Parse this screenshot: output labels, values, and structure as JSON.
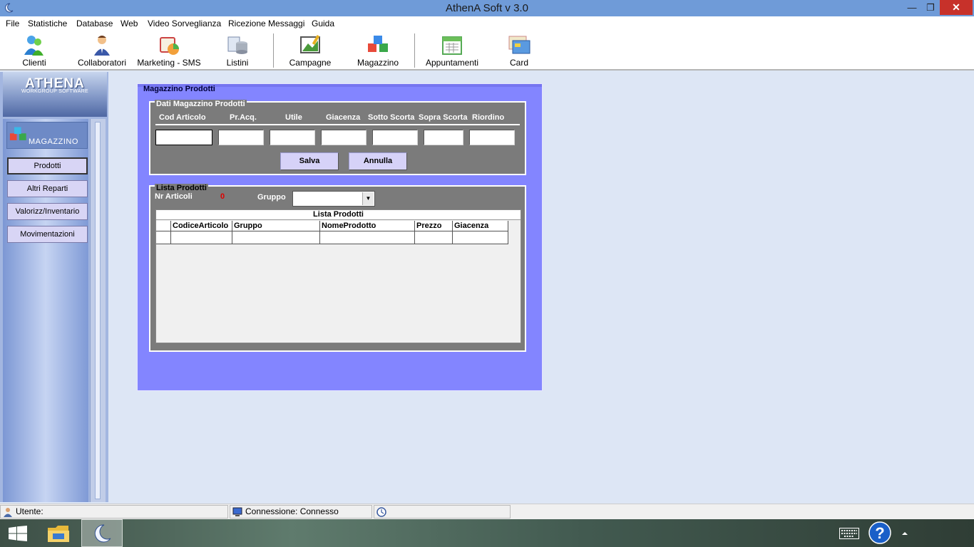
{
  "window": {
    "title": "AthenA Soft v 3.0",
    "min_symbol": "—",
    "max_symbol": "❐",
    "close_symbol": "✕"
  },
  "menu": [
    "File",
    "Statistiche",
    "Database",
    "Web",
    "Video Sorveglianza",
    "Ricezione Messaggi",
    "Guida"
  ],
  "toolbar": [
    {
      "label": "Clienti",
      "icon": "clients-icon"
    },
    {
      "label": "Collaboratori",
      "icon": "collaborators-icon"
    },
    {
      "label": "Marketing - SMS",
      "icon": "marketing-icon"
    },
    {
      "label": "Listini",
      "icon": "pricelist-icon"
    },
    {
      "label": "Campagne",
      "icon": "campaign-icon"
    },
    {
      "label": "Magazzino",
      "icon": "warehouse-icon"
    },
    {
      "label": "Appuntamenti",
      "icon": "calendar-icon"
    },
    {
      "label": "Card",
      "icon": "card-icon"
    }
  ],
  "sidebar": {
    "logo_name": "ATHENA",
    "logo_sub": "WORKGROUP SOFTWARE",
    "module": "MAGAZZINO",
    "items": [
      "Prodotti",
      "Altri Reparti",
      "Valorizz/Inventario",
      "Movimentazioni"
    ],
    "active_item": "Prodotti"
  },
  "form": {
    "title": "Magazzino Prodotti",
    "data_section": {
      "title": "Dati Magazzino Prodotti",
      "fields": [
        {
          "label": "Cod Articolo",
          "value": ""
        },
        {
          "label": "Pr.Acq.",
          "value": ""
        },
        {
          "label": "Utile",
          "value": ""
        },
        {
          "label": "Giacenza",
          "value": ""
        },
        {
          "label": "Sotto Scorta",
          "value": ""
        },
        {
          "label": "Sopra Scorta",
          "value": ""
        },
        {
          "label": "Riordino",
          "value": ""
        }
      ],
      "save_label": "Salva",
      "cancel_label": "Annulla"
    },
    "list_section": {
      "title": "Lista Prodotti",
      "count_label": "Nr Articoli",
      "count_value": "0",
      "group_label": "Gruppo",
      "group_value": "",
      "grid_title": "Lista Prodotti",
      "columns": [
        "CodiceArticolo",
        "Gruppo",
        "NomeProdotto",
        "Prezzo",
        "Giacenza"
      ],
      "rows": []
    }
  },
  "statusbar": {
    "user": "Utente:",
    "connection": "Connessione: Connesso"
  },
  "colors": {
    "titlebar": "#6f9bd8",
    "form_background": "#8385ff",
    "fieldset_background": "#7b7b7b",
    "button_face": "#d6d2f8",
    "count_text": "#e00000",
    "close_button": "#c7312a"
  }
}
